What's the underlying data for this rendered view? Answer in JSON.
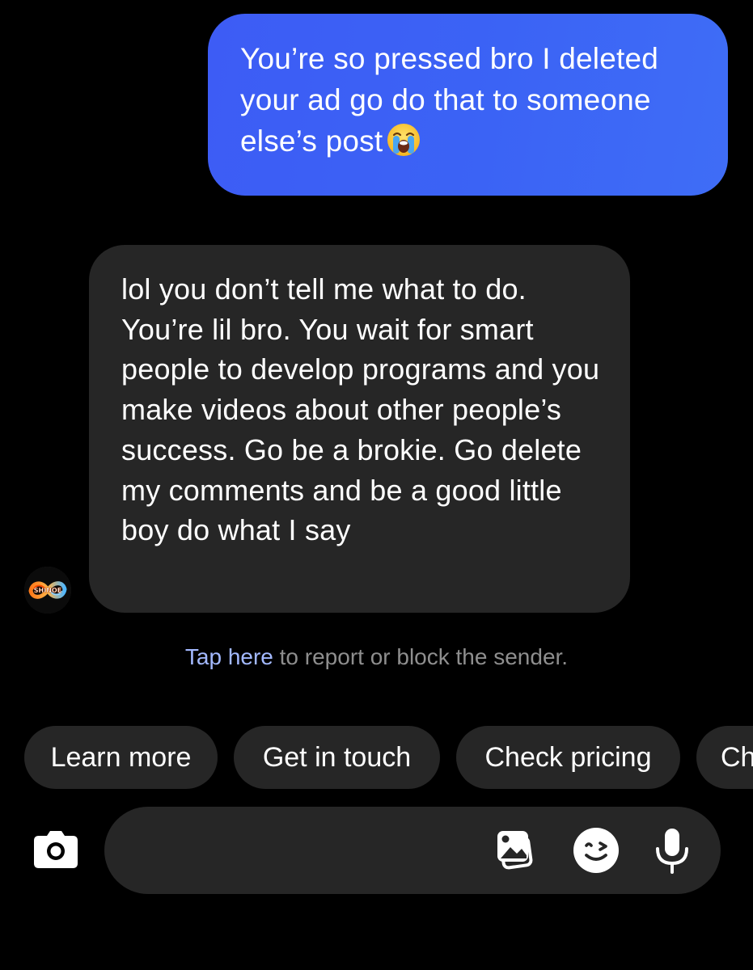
{
  "outgoing_message": {
    "text": "You’re so pressed bro I deleted your ad go do that to someone else’s post",
    "emoji": "loudly-crying-face"
  },
  "incoming_message": {
    "text": "lol you don’t tell me what to do. You’re lil bro. You wait for smart people to develop programs and you make videos about other people’s success. Go be a brokie. Go delete my comments and be a good little boy do what I say"
  },
  "sender_avatar": {
    "label": "SHINOE"
  },
  "report": {
    "link_text": "Tap here",
    "rest_text": " to report or block the sender."
  },
  "quick_replies": [
    {
      "label": "Learn more"
    },
    {
      "label": "Get in touch"
    },
    {
      "label": "Check pricing"
    },
    {
      "label": "Ch"
    }
  ],
  "composer": {
    "placeholder": "",
    "icons": [
      "camera-icon",
      "gallery-icon",
      "sticker-icon",
      "microphone-icon"
    ]
  },
  "colors": {
    "outgoing_bubble": "#3b63f5",
    "incoming_bubble": "#262626",
    "link": "#a3b9ff",
    "background": "#000000"
  }
}
